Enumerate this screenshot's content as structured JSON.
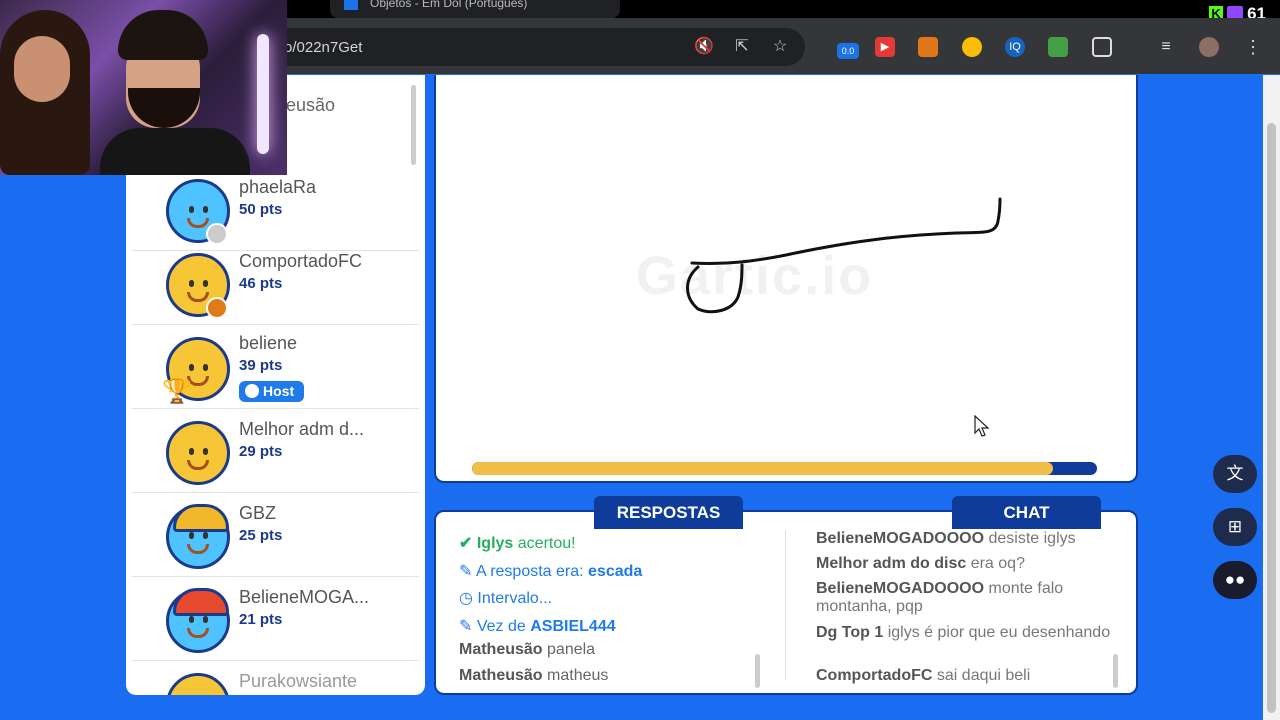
{
  "browser": {
    "tab_title": "Objetos - Em Dol (Português)",
    "url": "o/022n7Get",
    "viewer_count": "61",
    "extension_badge": "0.0"
  },
  "players": {
    "top_partial_name": "eusão",
    "list": [
      {
        "name": "phaelaRa",
        "points": "50 pts"
      },
      {
        "name": "ComportadoFC",
        "points": "46 pts"
      },
      {
        "name": "beliene",
        "points": "39 pts",
        "host_label": "Host",
        "rank": "1"
      },
      {
        "name": "Melhor adm d...",
        "points": "29 pts"
      },
      {
        "name": "GBZ",
        "points": "25 pts"
      },
      {
        "name": "BelieneMOGA...",
        "points": "21 pts"
      },
      {
        "name": "Purakowsiante",
        "points": ""
      }
    ]
  },
  "canvas": {
    "watermark": "Gartic.io",
    "timer_progress": 0.93
  },
  "answers": {
    "header": "RESPOSTAS",
    "line1_user": "Iglys",
    "line1_text": "acertou!",
    "line2_prefix": "A resposta era:",
    "line2_word": "escada",
    "line3": "Intervalo...",
    "line4_prefix": "Vez de",
    "line4_user": "ASBIEL444",
    "line5_user": "Matheusão",
    "line5_text": "panela",
    "line6_user": "Matheusão",
    "line6_text": "matheus"
  },
  "chat": {
    "header": "CHAT",
    "messages": [
      {
        "user": "BelieneMOGADOOOO",
        "text": "desiste iglys"
      },
      {
        "user": "Melhor adm do disc",
        "text": "era oq?"
      },
      {
        "user": "BelieneMOGADOOOO",
        "text": "monte falo montanha, pqp"
      },
      {
        "user": "Dg Top 1",
        "text": "iglys é pior que eu desenhando"
      },
      {
        "user": "ComportadoFC",
        "text": "sai daqui beli"
      }
    ]
  },
  "colors": {
    "background": "#1a6df0",
    "panel_border": "#0f3c9a",
    "timer_fill": "#f1bf48",
    "accent_blue": "#1f7bea",
    "correct_green": "#27ae60"
  }
}
